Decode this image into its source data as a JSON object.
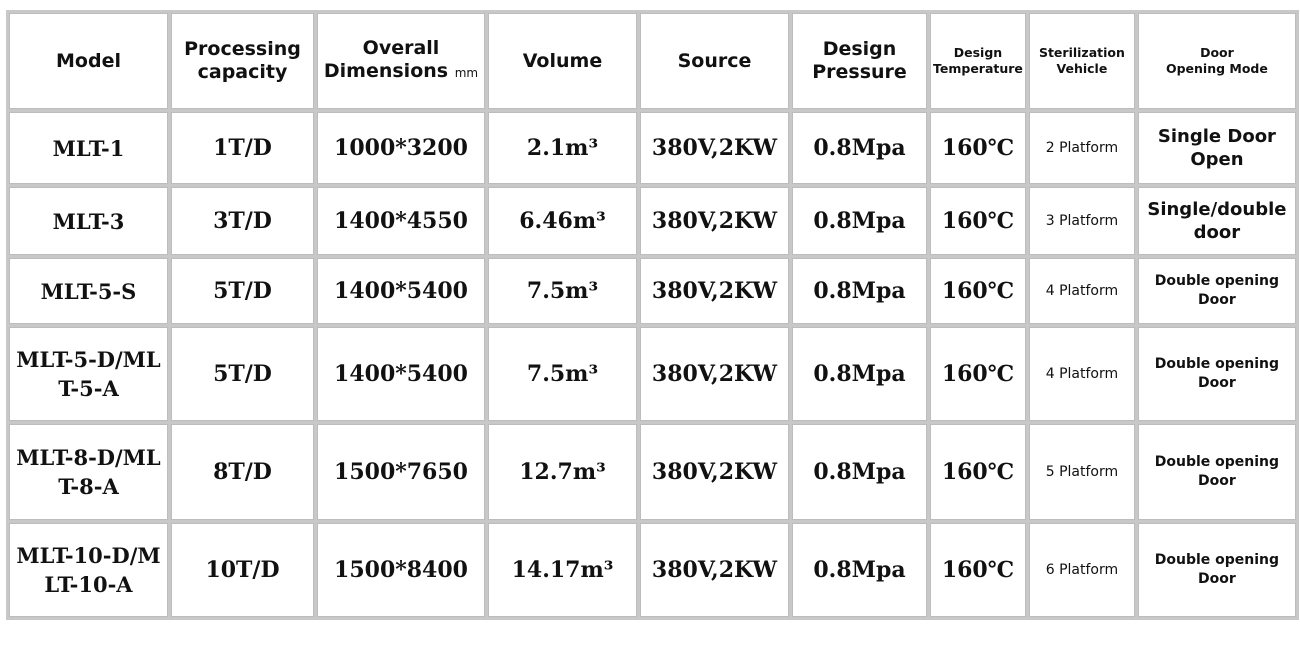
{
  "headers": {
    "model": "Model",
    "capacity_l1": "Processing",
    "capacity_l2": "capacity",
    "dims_l1": "Overall",
    "dims_l2": "Dimensions",
    "dims_unit": "mm",
    "volume": "Volume",
    "source": "Source",
    "pressure_l1": "Design",
    "pressure_l2": "Pressure",
    "temp_l1": "Design",
    "temp_l2": "Temperature",
    "vehicle_l1": "Sterilization",
    "vehicle_l2": "Vehicle",
    "door_l1": "Door",
    "door_l2": "Opening Mode"
  },
  "rows": [
    {
      "model_l1": "MLT-1",
      "model_l2": "",
      "capacity": "1T/D",
      "dimensions": "1000*3200",
      "volume": "2.1m³",
      "source": "380V,2KW",
      "pressure": "0.8Mpa",
      "temperature": "160℃",
      "vehicle": "2 Platform",
      "door_l1": "Single Door",
      "door_l2": "Open"
    },
    {
      "model_l1": "MLT-3",
      "model_l2": "",
      "capacity": "3T/D",
      "dimensions": "1400*4550",
      "volume": "6.46m³",
      "source": "380V,2KW",
      "pressure": "0.8Mpa",
      "temperature": "160℃",
      "vehicle": "3 Platform",
      "door_l1": "Single/double",
      "door_l2": "door"
    },
    {
      "model_l1": "MLT-5-S",
      "model_l2": "",
      "capacity": "5T/D",
      "dimensions": "1400*5400",
      "volume": "7.5m³",
      "source": "380V,2KW",
      "pressure": "0.8Mpa",
      "temperature": "160℃",
      "vehicle": "4 Platform",
      "door_l1": "Double opening",
      "door_l2": "Door"
    },
    {
      "model_l1": "MLT-5-D/ML",
      "model_l2": "T-5-A",
      "capacity": "5T/D",
      "dimensions": "1400*5400",
      "volume": "7.5m³",
      "source": "380V,2KW",
      "pressure": "0.8Mpa",
      "temperature": "160℃",
      "vehicle": "4 Platform",
      "door_l1": "Double opening",
      "door_l2": "Door"
    },
    {
      "model_l1": "MLT-8-D/ML",
      "model_l2": "T-8-A",
      "capacity": "8T/D",
      "dimensions": "1500*7650",
      "volume": "12.7m³",
      "source": "380V,2KW",
      "pressure": "0.8Mpa",
      "temperature": "160℃",
      "vehicle": "5 Platform",
      "door_l1": "Double opening",
      "door_l2": "Door"
    },
    {
      "model_l1": "MLT-10-D/M",
      "model_l2": "LT-10-A",
      "capacity": "10T/D",
      "dimensions": "1500*8400",
      "volume": "14.17m³",
      "source": "380V,2KW",
      "pressure": "0.8Mpa",
      "temperature": "160℃",
      "vehicle": "6 Platform",
      "door_l1": "Double opening",
      "door_l2": "Door"
    }
  ]
}
